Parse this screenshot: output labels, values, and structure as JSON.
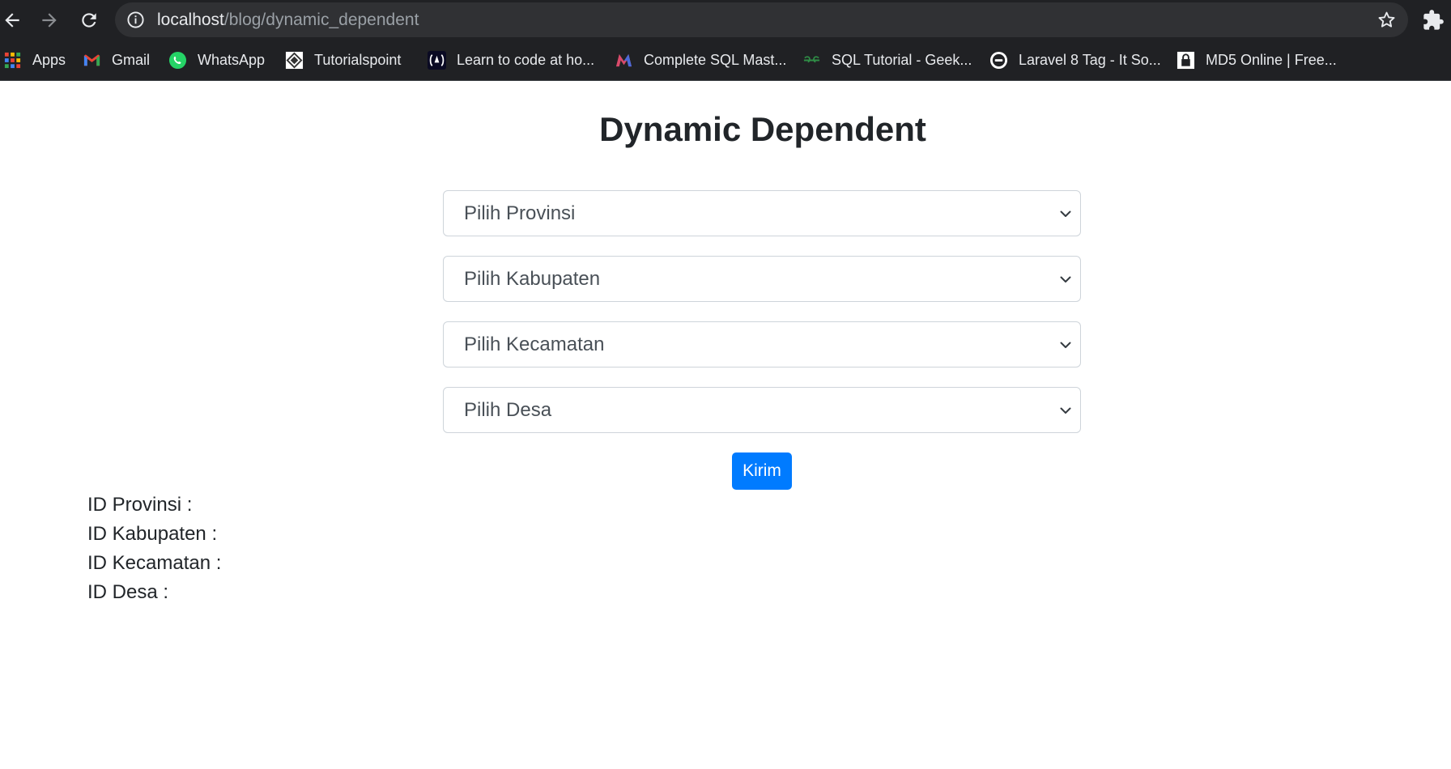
{
  "browser": {
    "url_host": "localhost",
    "url_path": "/blog/dynamic_dependent",
    "bookmarks": [
      {
        "label": "Apps",
        "icon": "apps-grid-icon"
      },
      {
        "label": "Gmail",
        "icon": "gmail-icon"
      },
      {
        "label": "WhatsApp",
        "icon": "whatsapp-icon"
      },
      {
        "label": "Tutorialspoint",
        "icon": "tutorialspoint-icon"
      },
      {
        "label": "Learn to code at ho...",
        "icon": "freecodecamp-icon"
      },
      {
        "label": "Complete SQL Mast...",
        "icon": "sql-mastery-icon"
      },
      {
        "label": "SQL Tutorial - Geek...",
        "icon": "geeksforgeeks-icon"
      },
      {
        "label": "Laravel 8 Tag - It So...",
        "icon": "itsolutionstuff-icon"
      },
      {
        "label": "MD5 Online | Free...",
        "icon": "md5-lock-icon"
      }
    ]
  },
  "page": {
    "title": "Dynamic Dependent",
    "selects": [
      {
        "name": "provinsi",
        "value": "Pilih Provinsi"
      },
      {
        "name": "kabupaten",
        "value": "Pilih Kabupaten"
      },
      {
        "name": "kecamatan",
        "value": "Pilih Kecamatan"
      },
      {
        "name": "desa",
        "value": "Pilih Desa"
      }
    ],
    "submit_label": "Kirim",
    "results": [
      "ID Provinsi :",
      "ID Kabupaten :",
      "ID Kecamatan :",
      "ID Desa :"
    ]
  },
  "colors": {
    "chrome_bg": "#202124",
    "omnibox_bg": "#303134",
    "primary_button": "#007bff",
    "text": "#212529",
    "select_text": "#495057",
    "select_border": "#ced4da"
  }
}
